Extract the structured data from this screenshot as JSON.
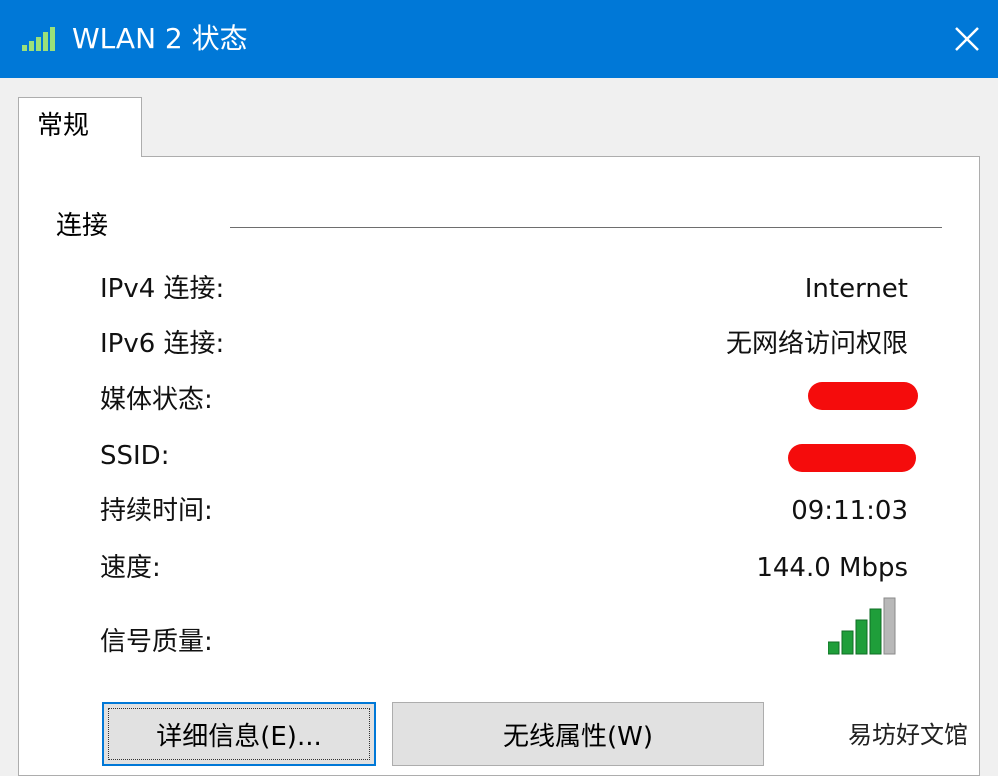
{
  "window": {
    "title": "WLAN 2 状态",
    "title_icon": "signal-strength-icon",
    "close_icon": "close-icon",
    "titlebar_color": "#0078d7"
  },
  "tabs": [
    {
      "label": "常规",
      "active": true
    }
  ],
  "connection": {
    "group_title": "连接",
    "rows": [
      {
        "label": "IPv4 连接:",
        "value": "Internet"
      },
      {
        "label": "IPv6 连接:",
        "value": "无网络访问权限"
      },
      {
        "label": "媒体状态:",
        "value": ""
      },
      {
        "label": "SSID:",
        "value": ""
      },
      {
        "label": "持续时间:",
        "value": "09:11:03"
      },
      {
        "label": "速度:",
        "value": "144.0 Mbps"
      },
      {
        "label": "信号质量:",
        "value": ""
      }
    ],
    "signal_quality_bars": 5,
    "signal_quality_filled": 4
  },
  "buttons": {
    "details": "详细信息(E)...",
    "wireless_properties": "无线属性(W)"
  },
  "watermark": "易坊好文馆"
}
